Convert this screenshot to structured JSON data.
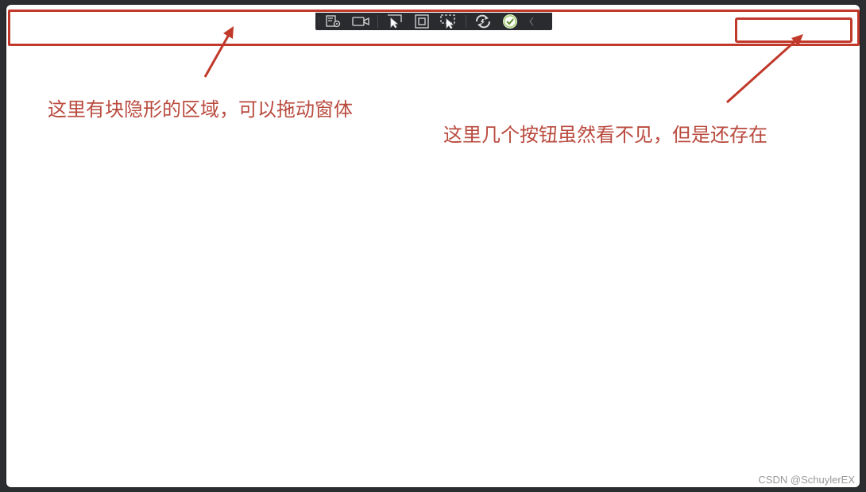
{
  "debug_toolbar": {
    "buttons": [
      {
        "icon": "live-visual-tree-icon"
      },
      {
        "icon": "record-icon"
      },
      {
        "icon": "select-element-icon"
      },
      {
        "icon": "display-layout-adorners-icon"
      },
      {
        "icon": "track-focused-element-icon"
      },
      {
        "icon": "hot-reload-icon"
      },
      {
        "icon": "hot-reload-status-icon"
      },
      {
        "icon": "collapse-toolbar-icon"
      }
    ]
  },
  "annotations": {
    "drag_region": "这里有块隐形的区域，可以拖动窗体",
    "buttons_region": "这里几个按钮虽然看不见，但是还存在"
  },
  "colors": {
    "annotation": "#c0392b",
    "toolbar_bg": "#2a2b2e",
    "status_ok": "#8bc34a"
  },
  "watermark": "CSDN @SchuylerEX"
}
